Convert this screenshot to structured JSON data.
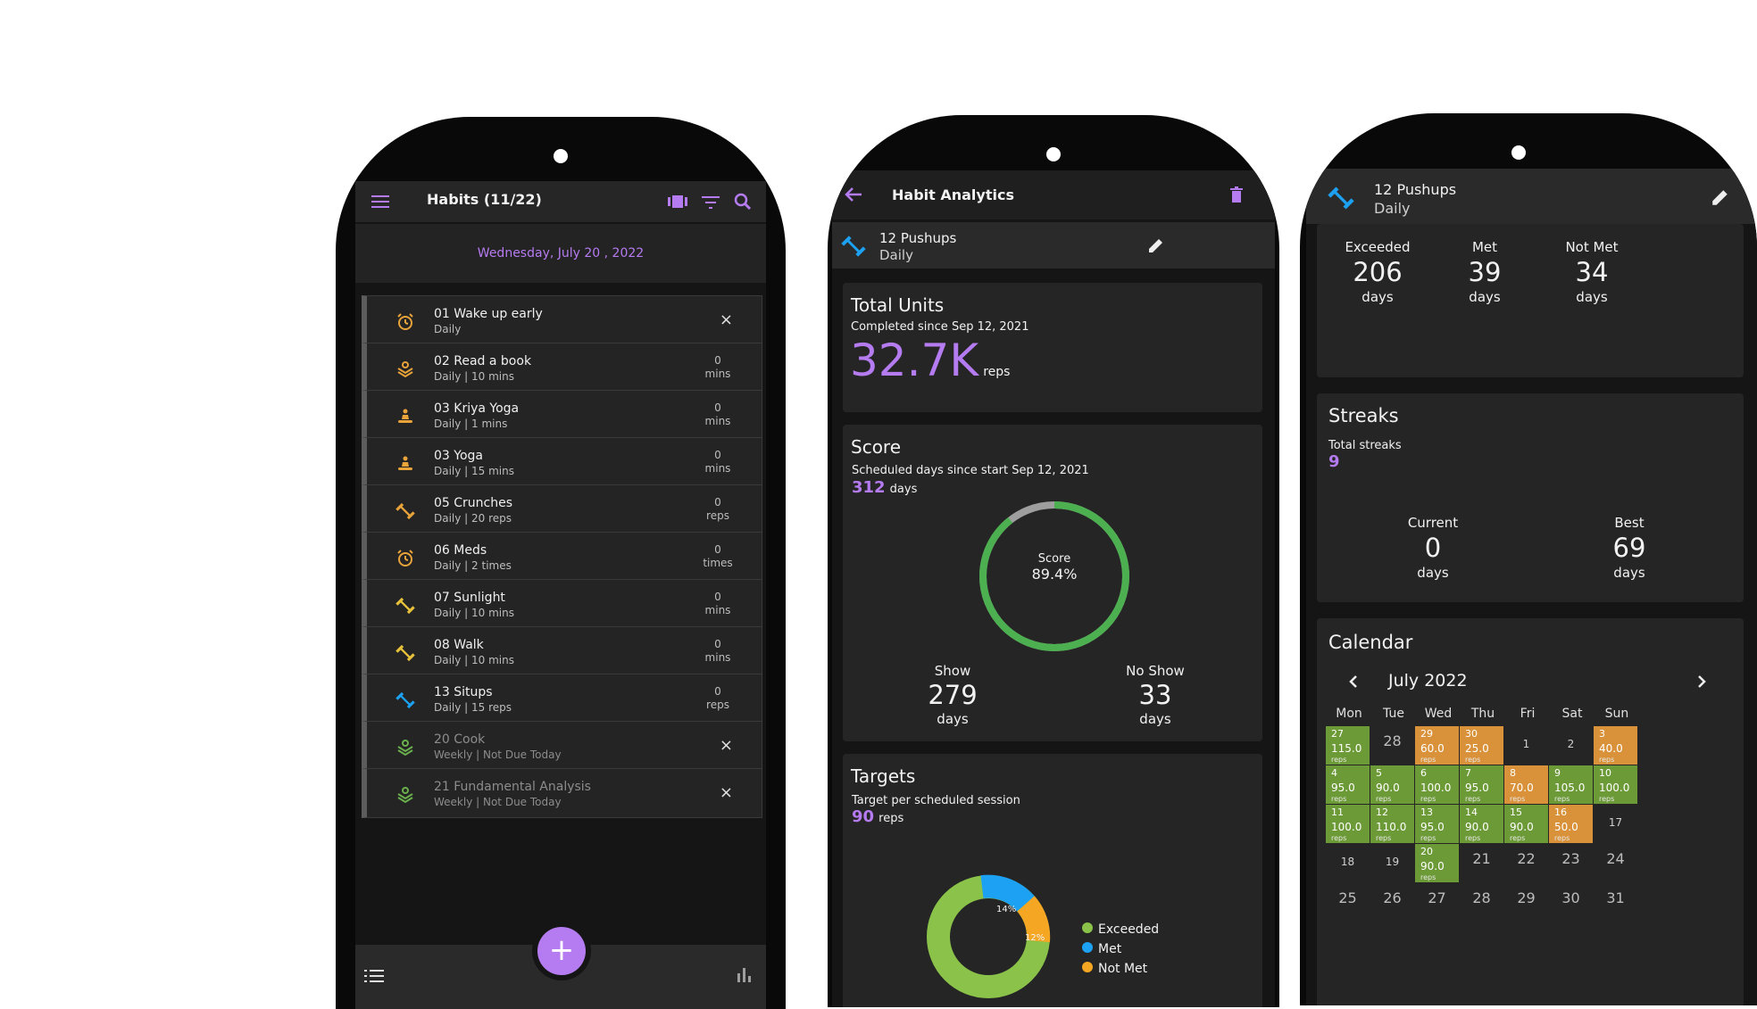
{
  "colors": {
    "accent": "#b57bf0",
    "exceeded": "#8bc34a",
    "met": "#1da1f2",
    "not_met": "#f5a623",
    "score": "#4caf50"
  },
  "habits_screen": {
    "title": "Habits (11/22)",
    "date_day": "Wednesday,",
    "date_rest": "July 20 , 2022",
    "icons": {
      "menu": "menu-icon",
      "carousel": "carousel-icon",
      "filter": "filter-icon",
      "search": "search-icon"
    },
    "habits": [
      {
        "name": "01 Wake up early",
        "sub": "Daily",
        "value": "",
        "unit": "",
        "action": "×",
        "icon": "alarm-icon",
        "color": "#e8a33a"
      },
      {
        "name": "02 Read a book",
        "sub": "Daily  | 10 mins",
        "value": "0",
        "unit": "mins",
        "action": "",
        "icon": "book-icon",
        "color": "#e8a33a"
      },
      {
        "name": "03 Kriya Yoga",
        "sub": "Daily  | 1 mins",
        "value": "0",
        "unit": "mins",
        "action": "",
        "icon": "yoga-icon",
        "color": "#e8a33a"
      },
      {
        "name": "03 Yoga",
        "sub": "Daily  | 15 mins",
        "value": "0",
        "unit": "mins",
        "action": "",
        "icon": "yoga-icon",
        "color": "#e8a33a"
      },
      {
        "name": "05 Crunches",
        "sub": "Daily  | 20 reps",
        "value": "0",
        "unit": "reps",
        "action": "",
        "icon": "dumbbell-icon",
        "color": "#e8a33a"
      },
      {
        "name": "06 Meds",
        "sub": "Daily  | 2 times",
        "value": "0",
        "unit": "times",
        "action": "",
        "icon": "alarm-icon",
        "color": "#e8a33a"
      },
      {
        "name": "07 Sunlight",
        "sub": "Daily  | 10 mins",
        "value": "0",
        "unit": "mins",
        "action": "",
        "icon": "dumbbell-icon",
        "color": "#e8c23a"
      },
      {
        "name": "08 Walk",
        "sub": "Daily  | 10 mins",
        "value": "0",
        "unit": "mins",
        "action": "",
        "icon": "dumbbell-icon",
        "color": "#e8c23a"
      },
      {
        "name": "13 Situps",
        "sub": "Daily  | 15 reps",
        "value": "0",
        "unit": "reps",
        "action": "",
        "icon": "dumbbell-icon",
        "color": "#1da1f2"
      },
      {
        "name": "20 Cook",
        "sub": "Weekly  | Not Due Today",
        "value": "",
        "unit": "",
        "action": "×",
        "icon": "book-icon",
        "color": "#6ab04c",
        "dim": true
      },
      {
        "name": "21 Fundamental Analysis",
        "sub": "Weekly  | Not Due Today",
        "value": "",
        "unit": "",
        "action": "×",
        "icon": "book-icon",
        "color": "#6ab04c",
        "dim": true
      }
    ],
    "fab": "+",
    "bottom_icons": {
      "list": "list-icon",
      "chart": "bar-chart-icon"
    }
  },
  "analytics_screen": {
    "title": "Habit Analytics",
    "habit_name": "12 Pushups",
    "habit_freq": "Daily",
    "total_units": {
      "heading": "Total Units",
      "sub": "Completed since Sep 12, 2021",
      "value": "32.7K",
      "unit": "reps"
    },
    "score": {
      "heading": "Score",
      "sub": "Scheduled days since start Sep 12, 2021",
      "days": "312",
      "days_unit": "days",
      "ring_label": "Score",
      "ring_value": "89.4%",
      "ring_fraction": 0.894,
      "show_label": "Show",
      "show_value": "279",
      "show_unit": "days",
      "noshow_label": "No Show",
      "noshow_value": "33",
      "noshow_unit": "days"
    },
    "targets": {
      "heading": "Targets",
      "sub": "Target per scheduled session",
      "value": "90",
      "unit": "reps",
      "legend": [
        "Exceeded",
        "Met",
        "Not Met"
      ],
      "slice_met": "14%",
      "slice_notmet": "12%"
    }
  },
  "detail_screen": {
    "habit_name": "12 Pushups",
    "habit_freq": "Daily",
    "stats": [
      {
        "label": "Exceeded",
        "value": "206",
        "unit": "days"
      },
      {
        "label": "Met",
        "value": "39",
        "unit": "days"
      },
      {
        "label": "Not Met",
        "value": "34",
        "unit": "days"
      }
    ],
    "streaks": {
      "heading": "Streaks",
      "sub": "Total streaks",
      "total": "9",
      "current_label": "Current",
      "current_value": "0",
      "current_unit": "days",
      "best_label": "Best",
      "best_value": "69",
      "best_unit": "days"
    },
    "calendar": {
      "heading": "Calendar",
      "month": "July 2022",
      "weekdays": [
        "Mon",
        "Tue",
        "Wed",
        "Thu",
        "Fri",
        "Sat",
        "Sun"
      ],
      "rows": [
        [
          {
            "d": "27",
            "v": "115.0",
            "s": "g"
          },
          {
            "d": "28",
            "s": "big"
          },
          {
            "d": "29",
            "v": "60.0",
            "s": "o"
          },
          {
            "d": "30",
            "v": "25.0",
            "s": "o"
          },
          {
            "d": "1",
            "s": "n"
          },
          {
            "d": "2",
            "s": "n"
          },
          {
            "d": "3",
            "v": "40.0",
            "s": "o"
          }
        ],
        [
          {
            "d": "4",
            "v": "95.0",
            "s": "g"
          },
          {
            "d": "5",
            "v": "90.0",
            "s": "g"
          },
          {
            "d": "6",
            "v": "100.0",
            "s": "g"
          },
          {
            "d": "7",
            "v": "95.0",
            "s": "g"
          },
          {
            "d": "8",
            "v": "70.0",
            "s": "o"
          },
          {
            "d": "9",
            "v": "105.0",
            "s": "g"
          },
          {
            "d": "10",
            "v": "100.0",
            "s": "g"
          }
        ],
        [
          {
            "d": "11",
            "v": "100.0",
            "s": "g"
          },
          {
            "d": "12",
            "v": "110.0",
            "s": "g"
          },
          {
            "d": "13",
            "v": "95.0",
            "s": "g"
          },
          {
            "d": "14",
            "v": "90.0",
            "s": "g"
          },
          {
            "d": "15",
            "v": "90.0",
            "s": "g"
          },
          {
            "d": "16",
            "v": "50.0",
            "s": "o"
          },
          {
            "d": "17",
            "s": "n"
          }
        ],
        [
          {
            "d": "18",
            "s": "n"
          },
          {
            "d": "19",
            "s": "n"
          },
          {
            "d": "20",
            "v": "90.0",
            "s": "g"
          },
          {
            "d": "21",
            "s": "big"
          },
          {
            "d": "22",
            "s": "big"
          },
          {
            "d": "23",
            "s": "big"
          },
          {
            "d": "24",
            "s": "big"
          }
        ],
        [
          {
            "d": "25",
            "s": "big"
          },
          {
            "d": "26",
            "s": "big"
          },
          {
            "d": "27",
            "s": "big"
          },
          {
            "d": "28",
            "s": "big"
          },
          {
            "d": "29",
            "s": "big"
          },
          {
            "d": "30",
            "s": "big"
          },
          {
            "d": "31",
            "s": "big"
          }
        ]
      ],
      "rep_unit": "reps"
    }
  }
}
